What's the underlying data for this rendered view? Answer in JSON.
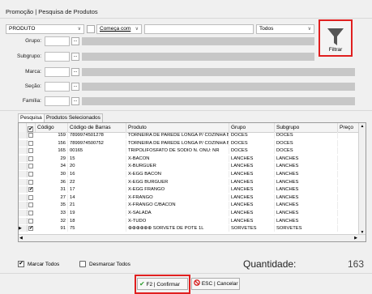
{
  "window": {
    "title": "Promoção | Pesquisa de Produtos"
  },
  "search": {
    "field_select": "PRODUTO",
    "mode_select": "Começa com",
    "query": "",
    "scope_select": "Todos"
  },
  "filters": [
    {
      "label": "Grupo:",
      "value": ""
    },
    {
      "label": "Subgrupo:",
      "value": ""
    },
    {
      "label": "Marca:",
      "value": ""
    },
    {
      "label": "Seção:",
      "value": ""
    },
    {
      "label": "Família:",
      "value": ""
    }
  ],
  "filter_button": {
    "label": "Filtrar",
    "icon": "funnel-icon"
  },
  "tabs": [
    "Pesquisa",
    "Produtos Selecionados"
  ],
  "grid": {
    "columns": [
      "Código",
      "Código de Barras",
      "Produto",
      "Grupo",
      "Subgrupo",
      "Preço"
    ],
    "rows": [
      {
        "checked": false,
        "code": "159",
        "barcode": "7899974501278",
        "product": "TORNEIRA DE PAREDE LONGA P/ COZINHA BI",
        "group": "DOCES",
        "subgroup": "DOCES"
      },
      {
        "checked": false,
        "code": "156",
        "barcode": "7899974500752",
        "product": "TORNEIRA DE PAREDE LONGA P/ COZINHA BI",
        "group": "DOCES",
        "subgroup": "DOCES"
      },
      {
        "checked": false,
        "code": "165",
        "barcode": "00165",
        "product": "TRIPOLIFOSFATO DE SODIO N. ONU: NR",
        "group": "DOCES",
        "subgroup": "DOCES"
      },
      {
        "checked": false,
        "code": "29",
        "barcode": "15",
        "product": "X-BACON",
        "group": "LANCHES",
        "subgroup": "LANCHES"
      },
      {
        "checked": false,
        "code": "34",
        "barcode": "20",
        "product": "X-BURGUER",
        "group": "LANCHES",
        "subgroup": "LANCHES"
      },
      {
        "checked": false,
        "code": "30",
        "barcode": "16",
        "product": "X-EGG BACON",
        "group": "LANCHES",
        "subgroup": "LANCHES"
      },
      {
        "checked": false,
        "code": "36",
        "barcode": "22",
        "product": "X-EGG BURGUER",
        "group": "LANCHES",
        "subgroup": "LANCHES"
      },
      {
        "checked": true,
        "code": "31",
        "barcode": "17",
        "product": "X-EGG FRANGO",
        "group": "LANCHES",
        "subgroup": "LANCHES"
      },
      {
        "checked": false,
        "code": "27",
        "barcode": "14",
        "product": "X-FRANGO",
        "group": "LANCHES",
        "subgroup": "LANCHES"
      },
      {
        "checked": false,
        "code": "35",
        "barcode": "21",
        "product": "X-FRANGO C/BACON",
        "group": "LANCHES",
        "subgroup": "LANCHES"
      },
      {
        "checked": false,
        "code": "33",
        "barcode": "19",
        "product": "X-SALADA",
        "group": "LANCHES",
        "subgroup": "LANCHES"
      },
      {
        "checked": false,
        "code": "32",
        "barcode": "18",
        "product": "X-TUDO",
        "group": "LANCHES",
        "subgroup": "LANCHES"
      },
      {
        "checked": true,
        "code": "91",
        "barcode": "75",
        "product": "⊕⊕⊕⊕⊕⊕ SORVETE DE POTE 1L",
        "group": "SORVETES",
        "subgroup": "SORVETES"
      }
    ]
  },
  "footer": {
    "mark_all": "Marcar Todos",
    "unmark_all": "Desmarcar Todos",
    "quantity_label": "Quantidade:",
    "quantity_value": "163",
    "confirm": "F2 | Confirmar",
    "cancel": "ESC | Cancelar"
  },
  "colors": {
    "highlight_border": "#e01f1f",
    "confirm_check": "#2e9e2e",
    "cancel_icon": "#d62020"
  }
}
